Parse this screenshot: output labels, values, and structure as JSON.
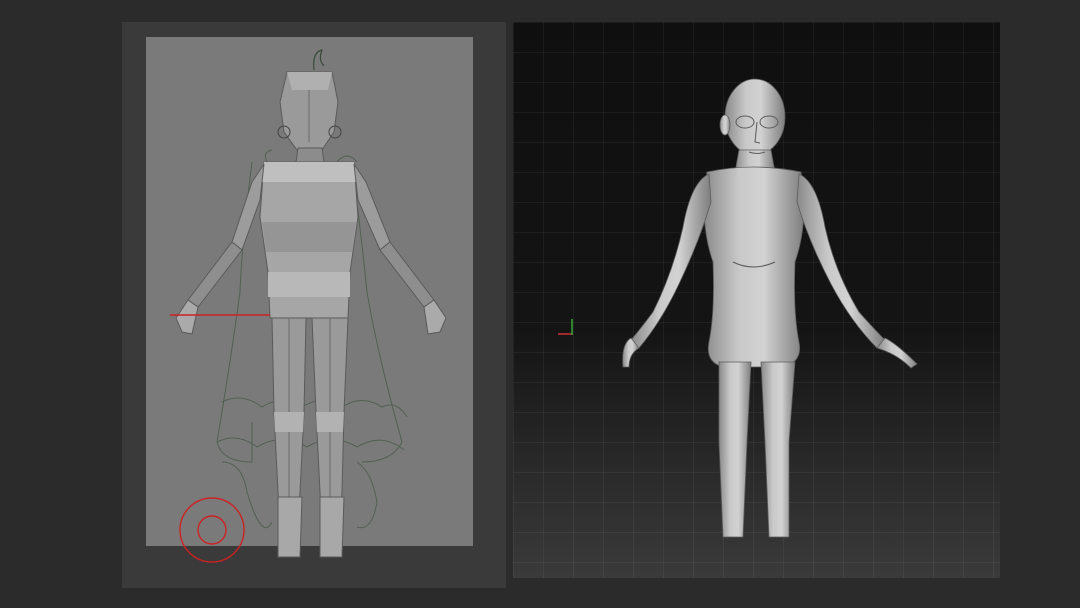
{
  "window": {
    "background_color": "#2b2b2b"
  },
  "left_view": {
    "viewport_color": "#3a3a3a",
    "canvas_color": "#7a7a7a",
    "subject": "low-poly-character-mesh",
    "accent_color": "#cc2222"
  },
  "right_view": {
    "subject": "sculpted-character-mesh",
    "axis_colors": {
      "x": "#cc3333",
      "y": "#33aa33"
    }
  }
}
